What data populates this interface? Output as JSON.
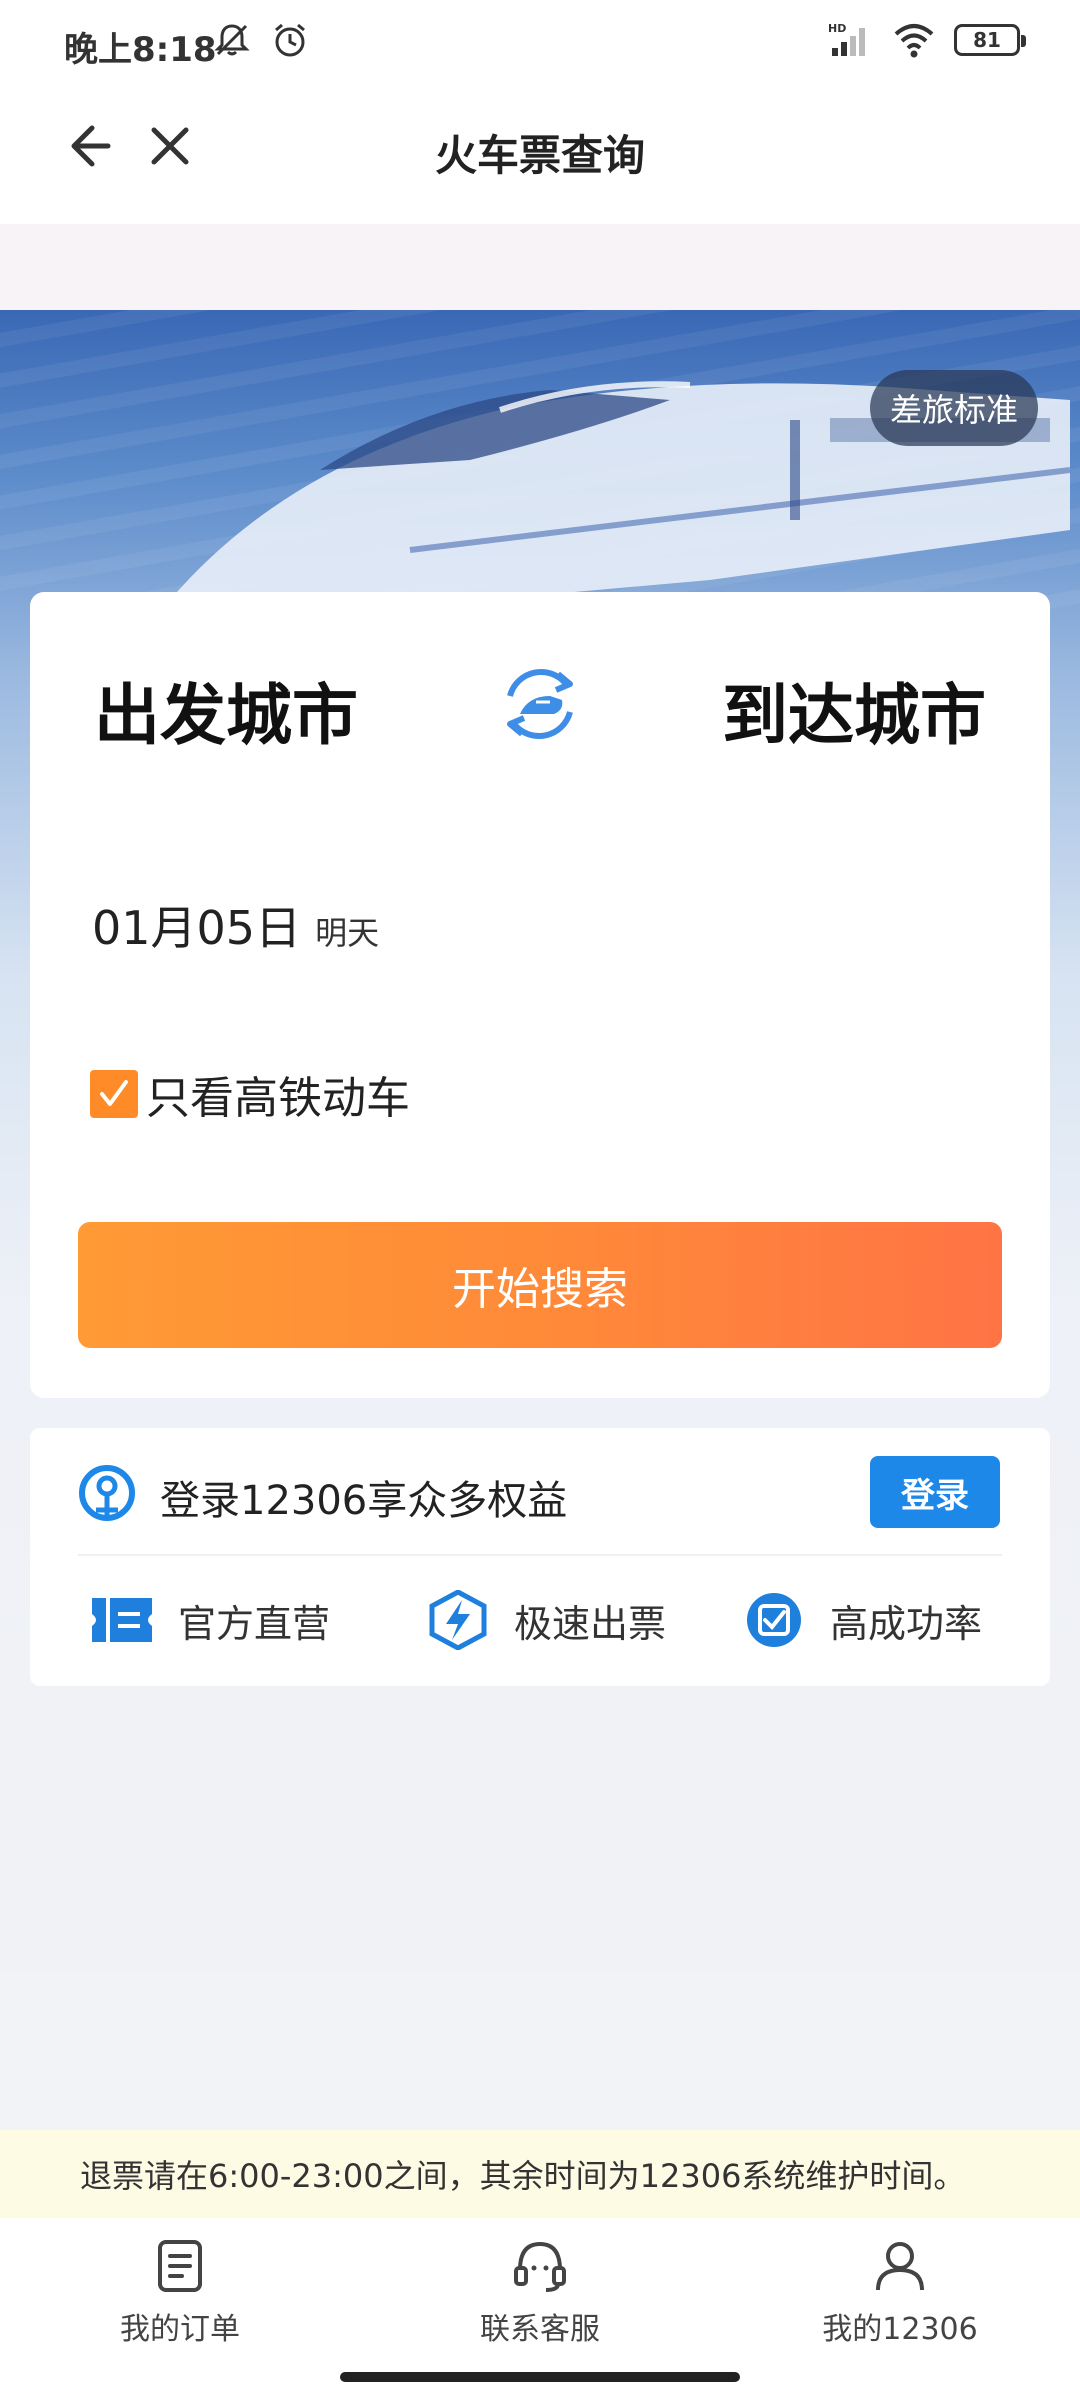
{
  "status_bar": {
    "time": "晚上8:18",
    "network": "HD",
    "battery": "81"
  },
  "nav": {
    "title": "火车票查询"
  },
  "hero": {
    "travel_standard": "差旅标准"
  },
  "search": {
    "from_city": "出发城市",
    "to_city": "到达城市",
    "date": "01月05日",
    "date_note": "明天",
    "checkbox_label": "只看高铁动车",
    "checkbox_checked": true,
    "search_button": "开始搜索"
  },
  "login": {
    "text": "登录12306享众多权益",
    "button": "登录",
    "features": [
      {
        "label": "官方直营",
        "icon": "ticket-icon"
      },
      {
        "label": "极速出票",
        "icon": "lightning-icon"
      },
      {
        "label": "高成功率",
        "icon": "check-badge-icon"
      }
    ]
  },
  "notice": {
    "text": "退票请在6:00-23:00之间，其余时间为12306系统维护时间。"
  },
  "tabbar": {
    "items": [
      {
        "label": "我的订单",
        "icon": "order-icon"
      },
      {
        "label": "联系客服",
        "icon": "headset-icon"
      },
      {
        "label": "我的12306",
        "icon": "user-icon"
      }
    ]
  },
  "colors": {
    "accent_orange": "#ff8a38",
    "brand_blue": "#1e88e8"
  }
}
